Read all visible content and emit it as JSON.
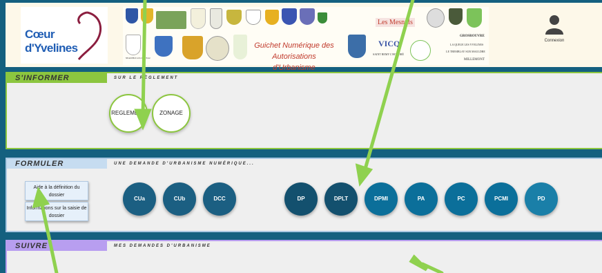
{
  "header": {
    "brand": "Cœur d'Yvelines",
    "guichet_line1": "Guichet Numérique des",
    "guichet_line2": "Autorisations d'Urbanisme",
    "account_label": "Connexion",
    "towns": [
      "Les Mesnuls",
      "VICQ",
      "SAINT REMY L'HONORÉ",
      "GROSROUVRE",
      "LA QUEUE LES YVELINES",
      "LE TREMBLAY SUR MAULDRE",
      "MILLEMONT",
      "NEAUPHLE-LE-CHÂTEAU"
    ]
  },
  "informer": {
    "tag": "S'INFORMER",
    "subtitle": "SUR LE RÈGLEMENT",
    "buttons": [
      "REGLEMENT",
      "ZONAGE"
    ]
  },
  "formuler": {
    "tag": "FORMULER",
    "subtitle": "UNE DEMANDE D'URBANISME NUMÉRIQUE...",
    "help_buttons": [
      "Aide à la définition du dossier",
      "Informations sur la saisie de dossier"
    ],
    "certificates": [
      "CUa",
      "CUb",
      "DCC"
    ],
    "permits": [
      "DP",
      "DPLT",
      "DPMI",
      "PA",
      "PC",
      "PCMI",
      "PD"
    ]
  },
  "suivre": {
    "tag": "SUIVRE",
    "subtitle": "MES DEMANDES D'URBANISME"
  },
  "colors": {
    "frame": "#14607f",
    "informer_green": "#8cc63f",
    "formuler_blue": "#c6dcf0",
    "suivre_purple": "#b89ef0",
    "permit_blue": "#0b6f9a",
    "arrow_green": "#8fd14f"
  }
}
